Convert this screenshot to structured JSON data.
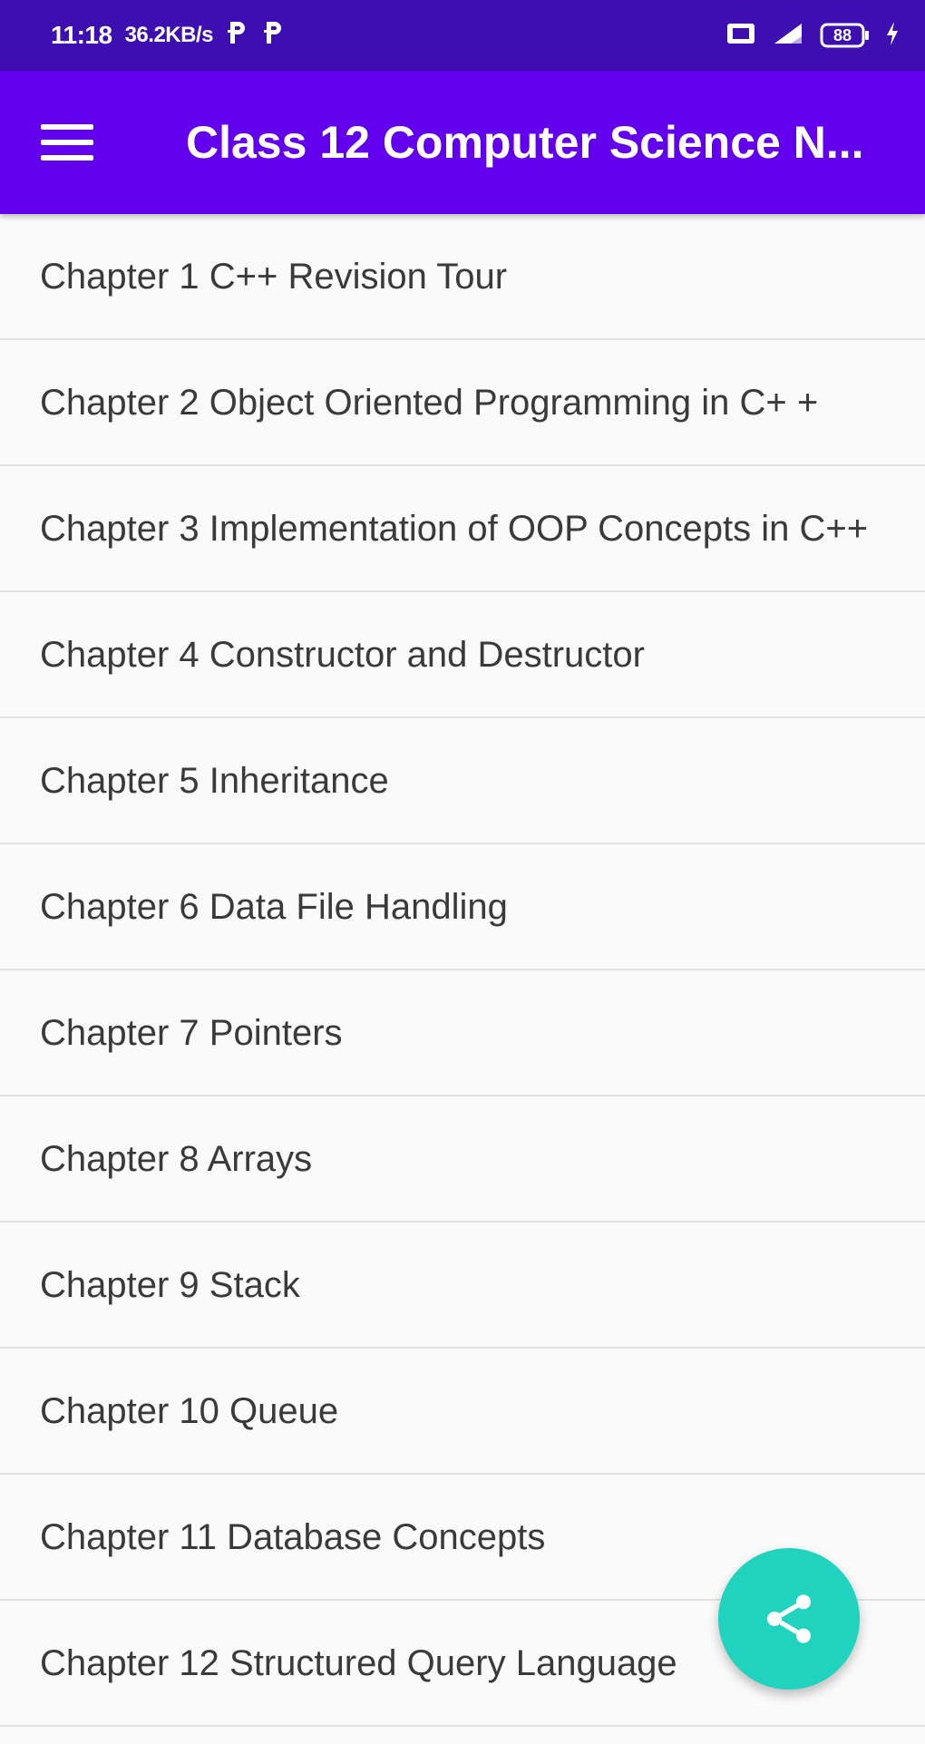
{
  "status_bar": {
    "time": "11:18",
    "network_speed": "36.2KB/s",
    "notification_icons": [
      "p-app-icon",
      "p-app-icon"
    ],
    "right_icons": [
      "sim-icon",
      "signal-icon",
      "battery-icon",
      "charging-icon"
    ],
    "battery_level": "88"
  },
  "app_bar": {
    "title": "Class 12 Computer Science N...",
    "menu_icon": "hamburger-menu-icon",
    "color": "#6200ee"
  },
  "chapters": [
    {
      "label": "Chapter 1 C++ Revision Tour"
    },
    {
      "label": "Chapter 2 Object Oriented Programming in C+ +"
    },
    {
      "label": "Chapter 3 Implementation of OOP Concepts in C++"
    },
    {
      "label": "Chapter 4 Constructor and Destructor"
    },
    {
      "label": "Chapter 5 Inheritance"
    },
    {
      "label": "Chapter 6 Data File Handling"
    },
    {
      "label": "Chapter 7 Pointers"
    },
    {
      "label": "Chapter 8 Arrays"
    },
    {
      "label": "Chapter 9 Stack"
    },
    {
      "label": "Chapter 10 Queue"
    },
    {
      "label": "Chapter 11 Database Concepts"
    },
    {
      "label": "Chapter 12 Structured Query Language"
    }
  ],
  "fab": {
    "icon": "share-icon",
    "color": "#1fd3be"
  }
}
